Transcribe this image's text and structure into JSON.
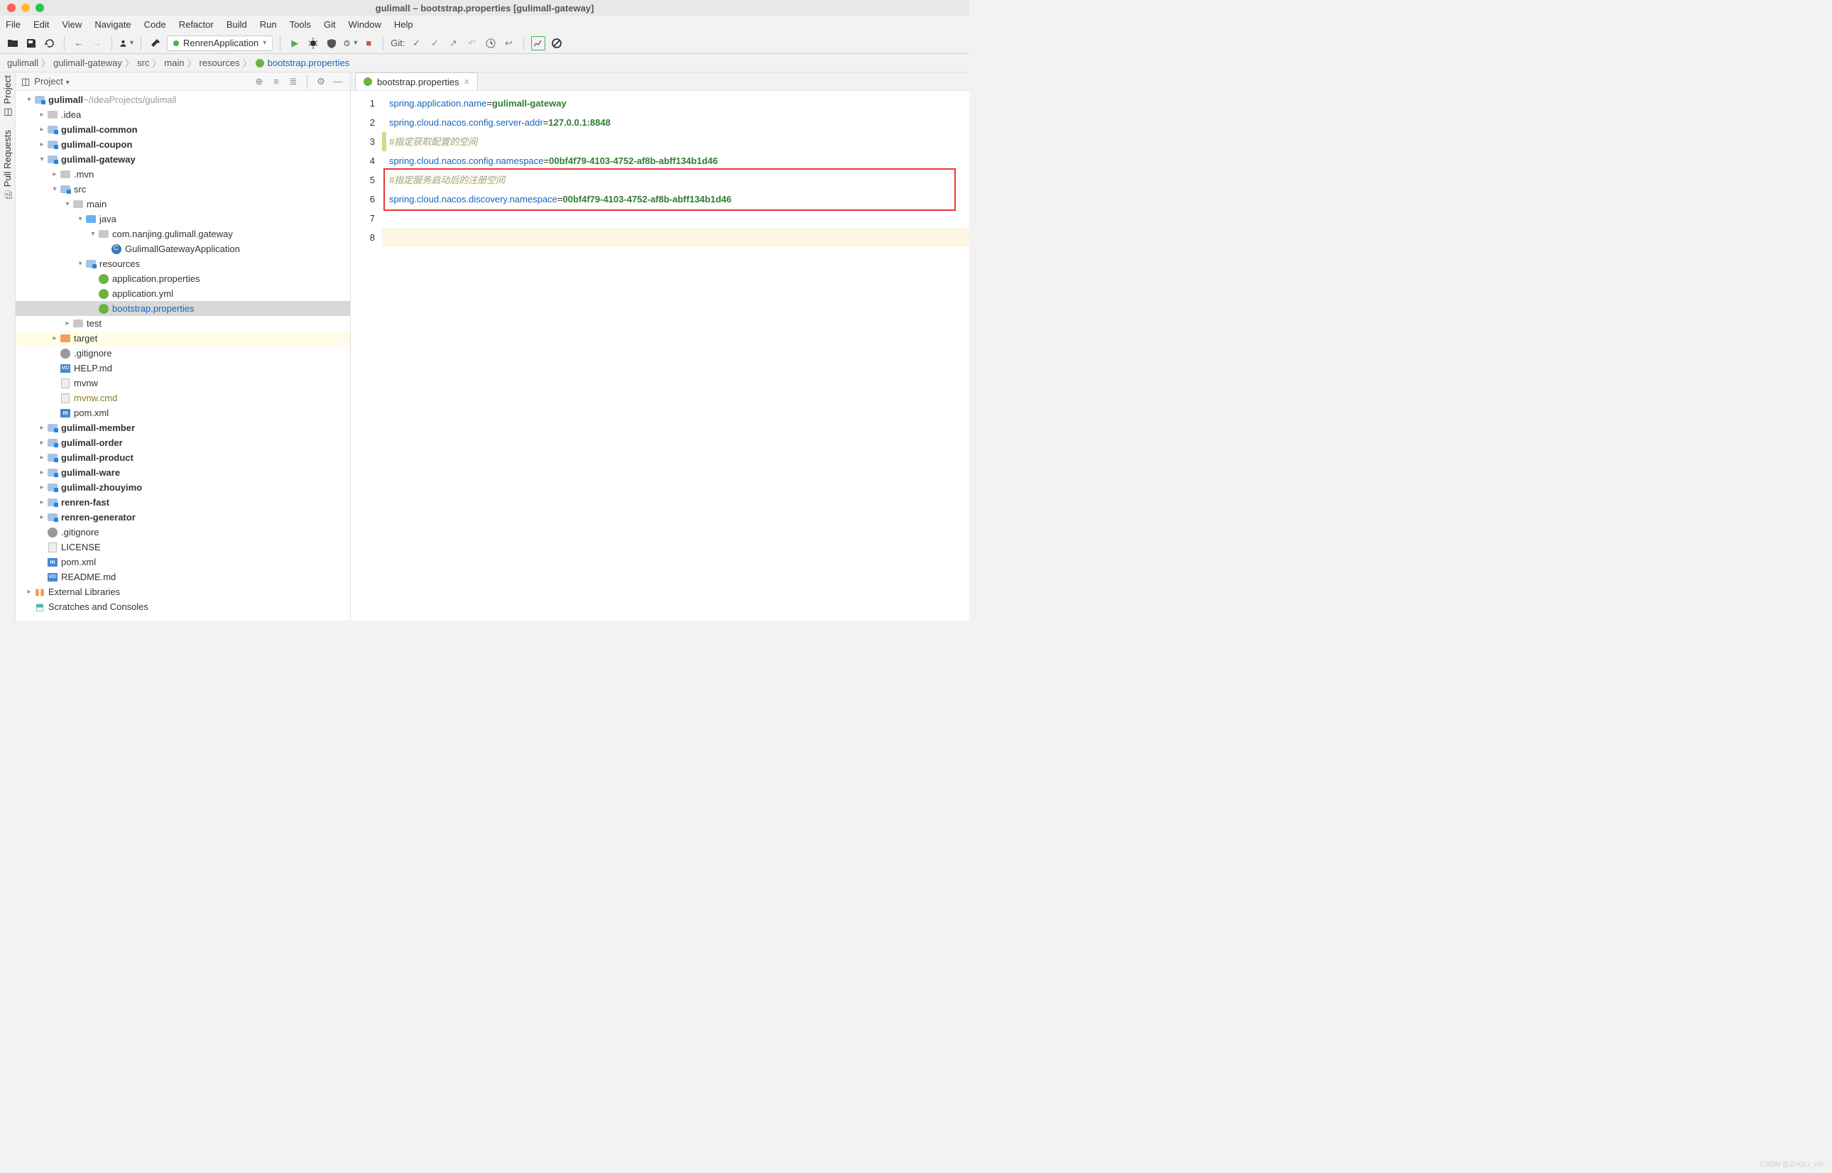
{
  "window": {
    "title": "gulimall – bootstrap.properties [gulimall-gateway]"
  },
  "menubar": [
    "File",
    "Edit",
    "View",
    "Navigate",
    "Code",
    "Refactor",
    "Build",
    "Run",
    "Tools",
    "Git",
    "Window",
    "Help"
  ],
  "toolbar": {
    "run_config": "RenrenApplication",
    "git_label": "Git:"
  },
  "breadcrumb": [
    "gulimall",
    "gulimall-gateway",
    "src",
    "main",
    "resources",
    "bootstrap.properties"
  ],
  "project_pane": {
    "title": "Project",
    "root": {
      "name": "gulimall",
      "path": "~/IdeaProjects/gulimall"
    },
    "tree": [
      {
        "d": 0,
        "exp": true,
        "kind": "mod",
        "label": "gulimall",
        "suffix": " ~/IdeaProjects/gulimall",
        "bold": true
      },
      {
        "d": 1,
        "exp": false,
        "kind": "grey",
        "label": ".idea"
      },
      {
        "d": 1,
        "exp": false,
        "kind": "mod",
        "label": "gulimall-common",
        "bold": true
      },
      {
        "d": 1,
        "exp": false,
        "kind": "mod",
        "label": "gulimall-coupon",
        "bold": true
      },
      {
        "d": 1,
        "exp": true,
        "kind": "mod",
        "label": "gulimall-gateway",
        "bold": true
      },
      {
        "d": 2,
        "exp": false,
        "kind": "grey",
        "label": ".mvn"
      },
      {
        "d": 2,
        "exp": true,
        "kind": "mod",
        "label": "src"
      },
      {
        "d": 3,
        "exp": true,
        "kind": "grey",
        "label": "main"
      },
      {
        "d": 4,
        "exp": true,
        "kind": "blue",
        "label": "java"
      },
      {
        "d": 5,
        "exp": true,
        "kind": "grey",
        "label": "com.nanjing.gulimall.gateway"
      },
      {
        "d": 6,
        "exp": null,
        "kind": "class",
        "label": "GulimallGatewayApplication"
      },
      {
        "d": 4,
        "exp": true,
        "kind": "mod",
        "label": "resources"
      },
      {
        "d": 5,
        "exp": null,
        "kind": "spring",
        "label": "application.properties"
      },
      {
        "d": 5,
        "exp": null,
        "kind": "spring",
        "label": "application.yml"
      },
      {
        "d": 5,
        "exp": null,
        "kind": "spring",
        "label": "bootstrap.properties",
        "selected": true,
        "blue": true
      },
      {
        "d": 3,
        "exp": false,
        "kind": "grey",
        "label": "test"
      },
      {
        "d": 2,
        "exp": false,
        "kind": "orange",
        "label": "target",
        "target": true
      },
      {
        "d": 2,
        "exp": null,
        "kind": "git",
        "label": ".gitignore"
      },
      {
        "d": 2,
        "exp": null,
        "kind": "md",
        "label": "HELP.md"
      },
      {
        "d": 2,
        "exp": null,
        "kind": "file",
        "label": "mvnw"
      },
      {
        "d": 2,
        "exp": null,
        "kind": "file",
        "label": "mvnw.cmd",
        "olive": true
      },
      {
        "d": 2,
        "exp": null,
        "kind": "m",
        "label": "pom.xml"
      },
      {
        "d": 1,
        "exp": false,
        "kind": "mod",
        "label": "gulimall-member",
        "bold": true
      },
      {
        "d": 1,
        "exp": false,
        "kind": "mod",
        "label": "gulimall-order",
        "bold": true
      },
      {
        "d": 1,
        "exp": false,
        "kind": "mod",
        "label": "gulimall-product",
        "bold": true
      },
      {
        "d": 1,
        "exp": false,
        "kind": "mod",
        "label": "gulimall-ware",
        "bold": true
      },
      {
        "d": 1,
        "exp": false,
        "kind": "mod",
        "label": "gulimall-zhouyimo",
        "bold": true
      },
      {
        "d": 1,
        "exp": false,
        "kind": "mod",
        "label": "renren-fast",
        "bold": true
      },
      {
        "d": 1,
        "exp": false,
        "kind": "mod",
        "label": "renren-generator",
        "bold": true
      },
      {
        "d": 1,
        "exp": null,
        "kind": "git",
        "label": ".gitignore"
      },
      {
        "d": 1,
        "exp": null,
        "kind": "file",
        "label": "LICENSE"
      },
      {
        "d": 1,
        "exp": null,
        "kind": "m",
        "label": "pom.xml"
      },
      {
        "d": 1,
        "exp": null,
        "kind": "md",
        "label": "README.md"
      },
      {
        "d": 0,
        "exp": false,
        "kind": "lib",
        "label": "External Libraries"
      },
      {
        "d": 0,
        "exp": null,
        "kind": "scratch",
        "label": "Scratches and Consoles"
      }
    ]
  },
  "editor": {
    "tab": "bootstrap.properties",
    "lines": [
      {
        "n": 1,
        "t": "kv",
        "k": "spring.application.name",
        "v": "gulimall-gateway"
      },
      {
        "n": 2,
        "t": "kv",
        "k": "spring.cloud.nacos.config.server-addr",
        "v": "127.0.0.1:8848"
      },
      {
        "n": 3,
        "t": "comment",
        "text": "#指定获取配置的空间",
        "bar": true
      },
      {
        "n": 4,
        "t": "kv",
        "k": "spring.cloud.nacos.config.namespace",
        "v": "00bf4f79-4103-4752-af8b-abff134b1d46"
      },
      {
        "n": 5,
        "t": "comment",
        "text": "#指定服务启动后的注册空间"
      },
      {
        "n": 6,
        "t": "kv",
        "k": "spring.cloud.nacos.discovery.namespace",
        "v": "00bf4f79-4103-4752-af8b-abff134b1d46"
      },
      {
        "n": 7,
        "t": "blank"
      },
      {
        "n": 8,
        "t": "blank",
        "cur": true
      }
    ]
  },
  "watermark": "CSDN @ZHOU_VIP",
  "sidebar_tabs": {
    "project": "Project",
    "pull": "Pull Requests"
  }
}
